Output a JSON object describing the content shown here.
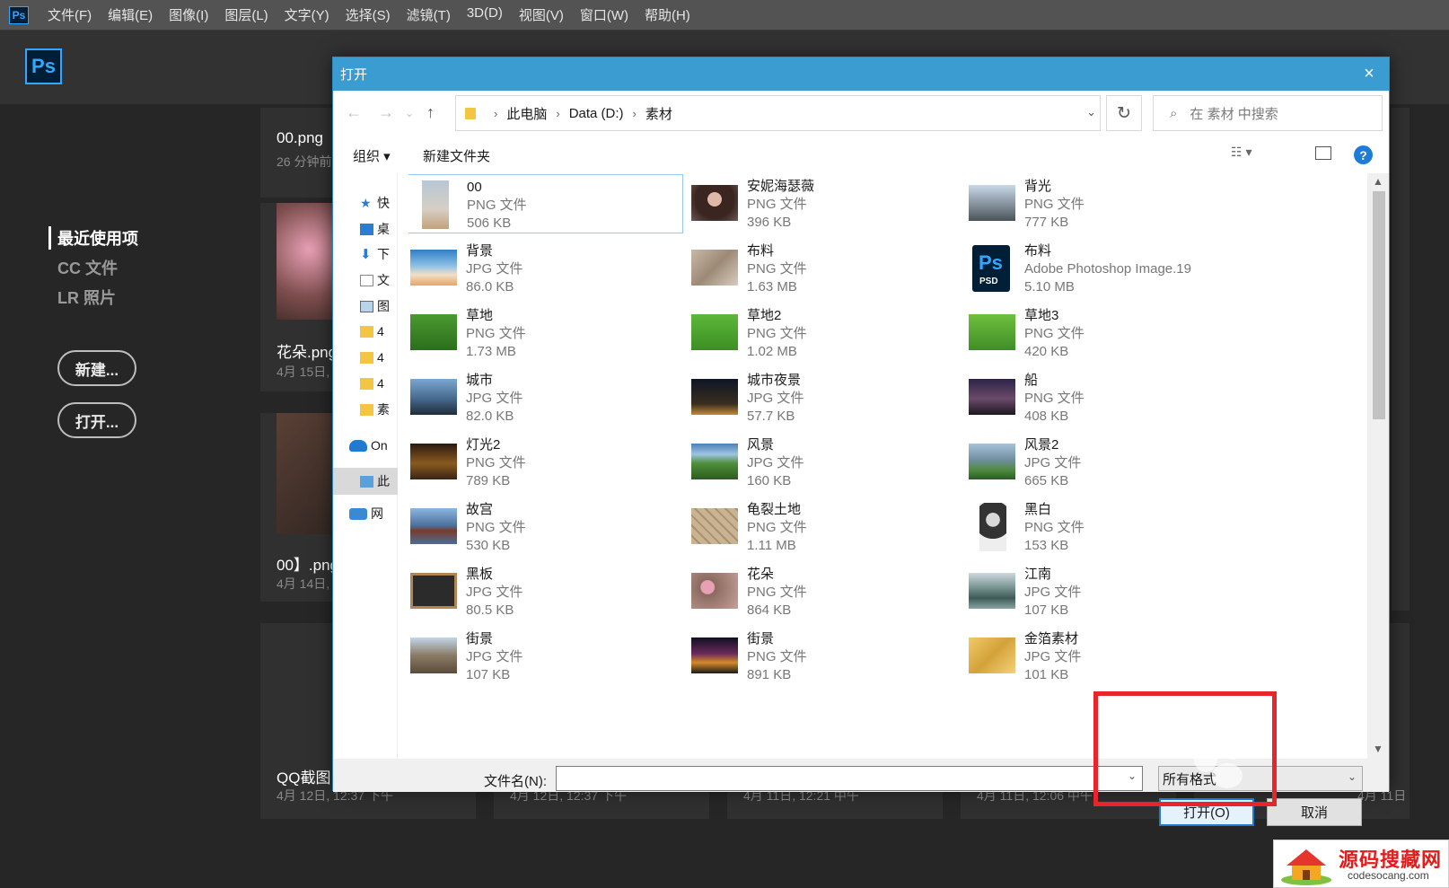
{
  "app": {
    "logo_text": "Ps",
    "menu": [
      "文件(F)",
      "编辑(E)",
      "图像(I)",
      "图层(L)",
      "文字(Y)",
      "选择(S)",
      "滤镜(T)",
      "3D(D)",
      "视图(V)",
      "窗口(W)",
      "帮助(H)"
    ]
  },
  "home": {
    "nav": [
      "最近使用项",
      "CC 文件",
      "LR 照片"
    ],
    "new_button": "新建...",
    "open_button": "打开...",
    "recent": [
      {
        "name": "00.png",
        "date": "26 分钟前"
      },
      {
        "name": "花朵.png",
        "date": "4月 15日,"
      },
      {
        "name": "00】.png",
        "date": "4月 14日,"
      },
      {
        "name": "QQ截图",
        "date": "4月 12日, 12:37 下午"
      }
    ],
    "bottom_dates": [
      "4月 12日, 12:37 下午",
      "4月 11日, 12:21 中午",
      "4月 11日, 12:06 中午",
      "4月 11日"
    ]
  },
  "dialog": {
    "title": "打开",
    "close_icon": "×",
    "breadcrumb": [
      "此电脑",
      "Data (D:)",
      "素材"
    ],
    "search_placeholder": "在 素材 中搜索",
    "organize": "组织 ▾",
    "new_folder": "新建文件夹",
    "help_icon": "?",
    "sidebar": [
      "快",
      "桌",
      "下",
      "文",
      "图",
      "4",
      "4",
      "4",
      "素",
      "On",
      "此",
      "网"
    ],
    "files": [
      {
        "name": "00",
        "type": "PNG 文件",
        "size": "506 KB",
        "thumb": "portrait-beach",
        "selected": true
      },
      {
        "name": "安妮海瑟薇",
        "type": "PNG 文件",
        "size": "396 KB",
        "thumb": "portrait-woman"
      },
      {
        "name": "背光",
        "type": "PNG 文件",
        "size": "777 KB",
        "thumb": "backlight"
      },
      {
        "name": "背景",
        "type": "JPG 文件",
        "size": "86.0 KB",
        "thumb": "sky"
      },
      {
        "name": "布料",
        "type": "PNG 文件",
        "size": "1.63 MB",
        "thumb": "fabric"
      },
      {
        "name": "布料",
        "type": "Adobe Photoshop Image.19",
        "size": "5.10 MB",
        "thumb": "psd"
      },
      {
        "name": "草地",
        "type": "PNG 文件",
        "size": "1.73 MB",
        "thumb": "grass"
      },
      {
        "name": "草地2",
        "type": "PNG 文件",
        "size": "1.02 MB",
        "thumb": "grass2"
      },
      {
        "name": "草地3",
        "type": "PNG 文件",
        "size": "420 KB",
        "thumb": "grass3"
      },
      {
        "name": "城市",
        "type": "JPG 文件",
        "size": "82.0 KB",
        "thumb": "city"
      },
      {
        "name": "城市夜景",
        "type": "JPG 文件",
        "size": "57.7 KB",
        "thumb": "citynight"
      },
      {
        "name": "船",
        "type": "PNG 文件",
        "size": "408 KB",
        "thumb": "boat"
      },
      {
        "name": "灯光2",
        "type": "PNG 文件",
        "size": "789 KB",
        "thumb": "lights"
      },
      {
        "name": "风景",
        "type": "JPG 文件",
        "size": "160 KB",
        "thumb": "landscape"
      },
      {
        "name": "风景2",
        "type": "JPG 文件",
        "size": "665 KB",
        "thumb": "landscape2"
      },
      {
        "name": "故宫",
        "type": "PNG 文件",
        "size": "530 KB",
        "thumb": "palace"
      },
      {
        "name": "龟裂土地",
        "type": "PNG 文件",
        "size": "1.11 MB",
        "thumb": "cracked"
      },
      {
        "name": "黑白",
        "type": "PNG 文件",
        "size": "153 KB",
        "thumb": "bw"
      },
      {
        "name": "黑板",
        "type": "JPG 文件",
        "size": "80.5 KB",
        "thumb": "blackboard"
      },
      {
        "name": "花朵",
        "type": "PNG 文件",
        "size": "864 KB",
        "thumb": "flowers"
      },
      {
        "name": "江南",
        "type": "JPG 文件",
        "size": "107 KB",
        "thumb": "jiangnan"
      },
      {
        "name": "街景",
        "type": "JPG 文件",
        "size": "107 KB",
        "thumb": "street"
      },
      {
        "name": "街景",
        "type": "PNG 文件",
        "size": "891 KB",
        "thumb": "streetnight"
      },
      {
        "name": "金箔素材",
        "type": "JPG 文件",
        "size": "101 KB",
        "thumb": "goldfoil"
      }
    ],
    "filename_label": "文件名(N):",
    "filename_value": "",
    "filetype": "所有格式",
    "open_button": "打开(O)",
    "cancel_button": "取消"
  },
  "watermark": {
    "top": "源码搜藏网",
    "bottom": "codesocang.com"
  }
}
